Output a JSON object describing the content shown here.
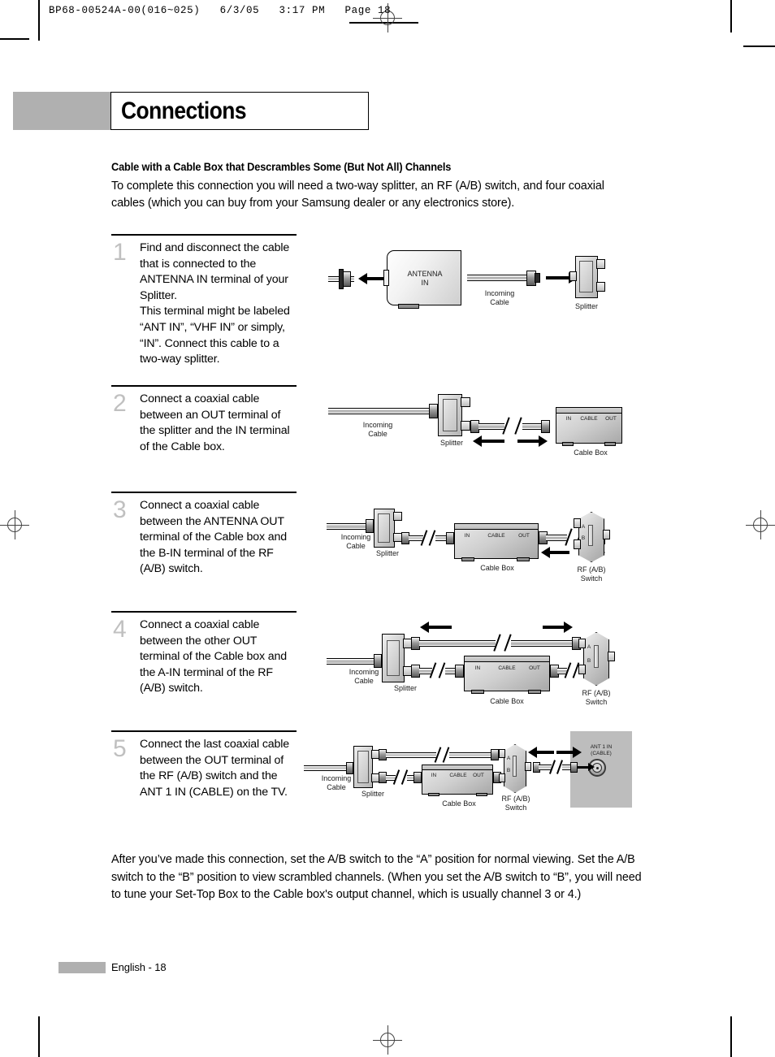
{
  "printer_header": "BP68-00524A-00(016~025)   6/3/05   3:17 PM   Page 18",
  "title": "Connections",
  "section": {
    "heading": "Cable with a Cable Box that Descrambles Some (But Not All) Channels",
    "intro": "To complete this connection you will need a two-way splitter, an RF (A/B) switch, and four coaxial cables (which you can buy from your Samsung dealer or any electronics store)."
  },
  "steps": [
    {
      "number": "1",
      "text": "Find and disconnect the cable that is connected to the ANTENNA IN terminal of your Splitter.\nThis terminal might be labeled “ANT IN”, “VHF IN” or simply, “IN”. Connect this cable to a two-way splitter."
    },
    {
      "number": "2",
      "text": "Connect a coaxial cable between an OUT terminal of the splitter and the IN terminal of the Cable box."
    },
    {
      "number": "3",
      "text": "Connect a coaxial cable between the ANTENNA OUT terminal of the Cable box and the B-IN terminal of the RF (A/B) switch."
    },
    {
      "number": "4",
      "text": "Connect a coaxial cable between the other OUT terminal of the Cable box and the A-IN terminal of the RF (A/B) switch."
    },
    {
      "number": "5",
      "text": "Connect the last coaxial cable between the OUT terminal of the RF (A/B) switch and the ANT 1 IN (CABLE) on the TV."
    }
  ],
  "diagrams": {
    "d1": {
      "antenna_label": "ANTENNA\nIN",
      "incoming_cable": "Incoming\nCable",
      "splitter": "Splitter"
    },
    "d2": {
      "incoming_cable": "Incoming\nCable",
      "splitter": "Splitter",
      "cable_box": "Cable Box",
      "box_in": "IN",
      "box_cable": "CABLE",
      "box_out": "OUT"
    },
    "d3": {
      "incoming_cable": "Incoming\nCable",
      "splitter": "Splitter",
      "cable_box": "Cable Box",
      "box_in": "IN",
      "box_cable": "CABLE",
      "box_out": "OUT",
      "rf_switch": "RF (A/B)\nSwitch",
      "rf_a": "A",
      "rf_b": "B"
    },
    "d4": {
      "incoming_cable": "Incoming\nCable",
      "splitter": "Splitter",
      "cable_box": "Cable Box",
      "box_in": "IN",
      "box_cable": "CABLE",
      "box_out": "OUT",
      "rf_switch": "RF (A/B)\nSwitch",
      "rf_a": "A",
      "rf_b": "B"
    },
    "d5": {
      "incoming_cable": "Incoming\nCable",
      "splitter": "Splitter",
      "cable_box": "Cable Box",
      "box_in": "IN",
      "box_cable": "CABLE",
      "box_out": "OUT",
      "rf_switch": "RF (A/B)\nSwitch",
      "rf_a": "A",
      "rf_b": "B",
      "tv_jack": "ANT 1 IN\n(CABLE)"
    }
  },
  "closing": "After you’ve made this connection, set the A/B switch to the “A” position for normal viewing. Set the A/B switch to the “B” position to view scrambled channels. (When you set the A/B switch to “B”, you will need to tune your Set-Top Box to the Cable box's output channel, which is usually channel 3 or 4.)",
  "footer": {
    "page_label": "English - 18"
  }
}
